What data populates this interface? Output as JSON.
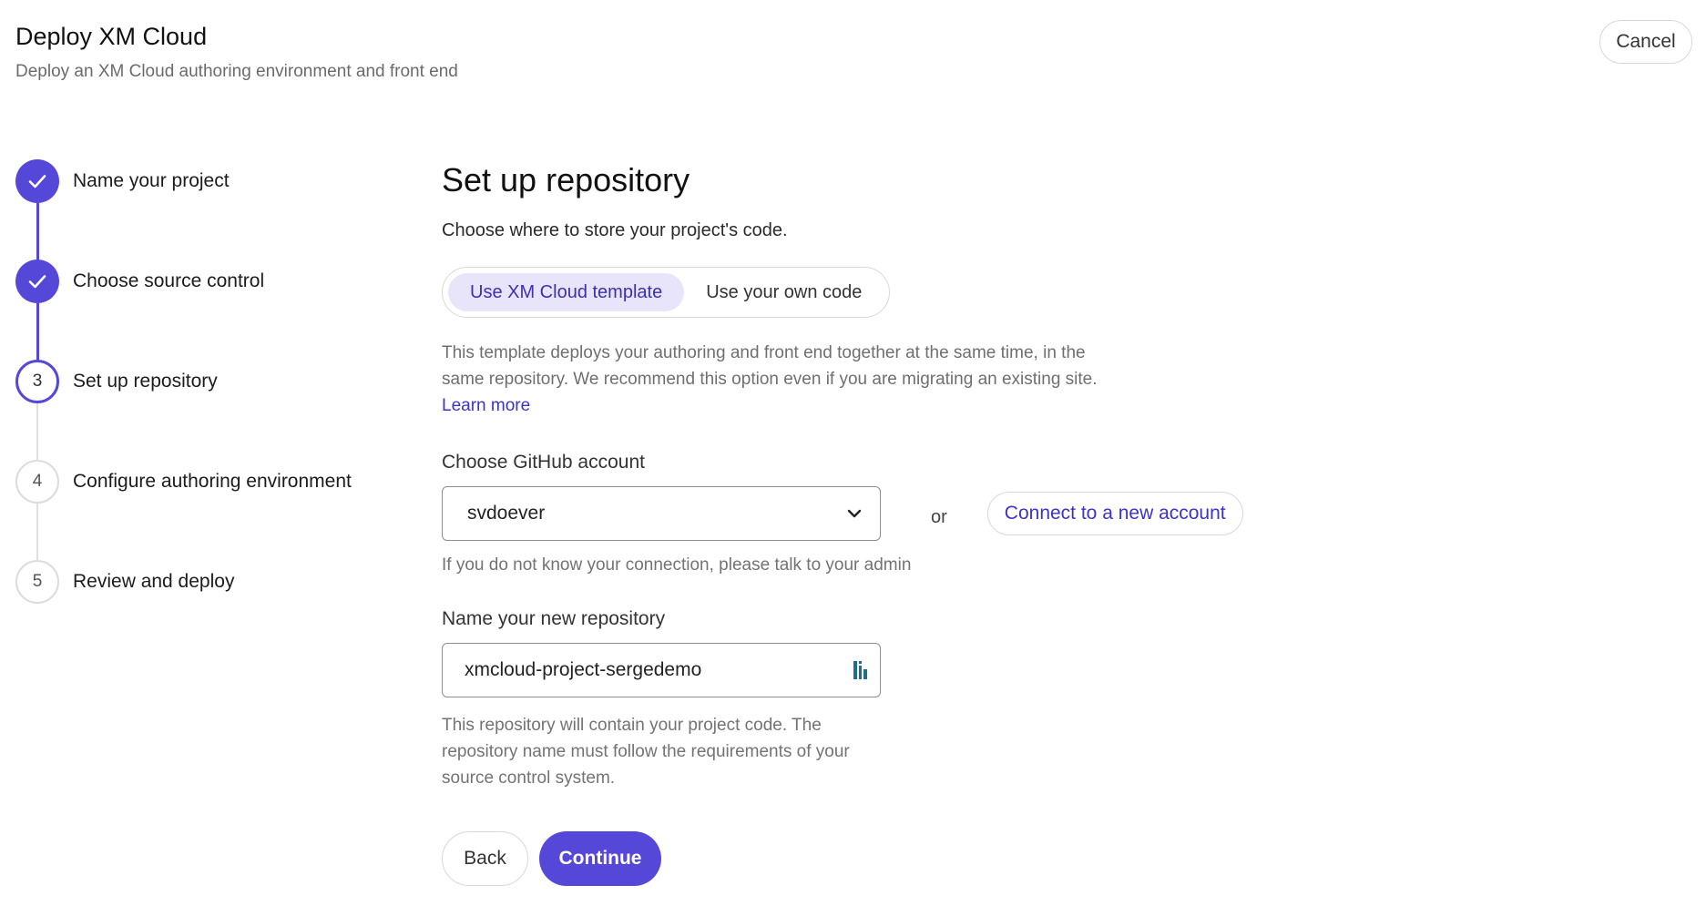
{
  "header": {
    "title": "Deploy XM Cloud",
    "subtitle": "Deploy an XM Cloud authoring environment and front end",
    "cancel_label": "Cancel"
  },
  "stepper": {
    "steps": [
      {
        "number": "1",
        "label": "Name your project",
        "status": "done"
      },
      {
        "number": "2",
        "label": "Choose source control",
        "status": "done"
      },
      {
        "number": "3",
        "label": "Set up repository",
        "status": "current"
      },
      {
        "number": "4",
        "label": "Configure authoring environment",
        "status": "pending"
      },
      {
        "number": "5",
        "label": "Review and deploy",
        "status": "pending"
      }
    ]
  },
  "main": {
    "title": "Set up repository",
    "description": "Choose where to store your project's code.",
    "toggle": {
      "options": [
        "Use XM Cloud template",
        "Use your own code"
      ],
      "selected": "Use XM Cloud template"
    },
    "info": "This template deploys your authoring and front end together at the same time, in the same repository. We recommend this option even if you are migrating an existing site. ",
    "learn_more": "Learn more",
    "account": {
      "label": "Choose GitHub account",
      "value": "svdoever",
      "or": "or",
      "connect_label": "Connect to a new account",
      "hint": "If you do not know your connection, please talk to your admin"
    },
    "repo": {
      "label": "Name your new repository",
      "value": "xmcloud-project-sergedemo",
      "hint": "This repository will contain your project code. The repository name must follow the requirements of your source control system."
    },
    "actions": {
      "back_label": "Back",
      "continue_label": "Continue"
    }
  },
  "colors": {
    "accent": "#5548d9",
    "accent_light": "#e8e5fb",
    "link": "#3d33c9"
  },
  "icons": {
    "check": "check-icon",
    "chevron": "chevron-down-icon",
    "password_manager": "password-manager-icon"
  }
}
